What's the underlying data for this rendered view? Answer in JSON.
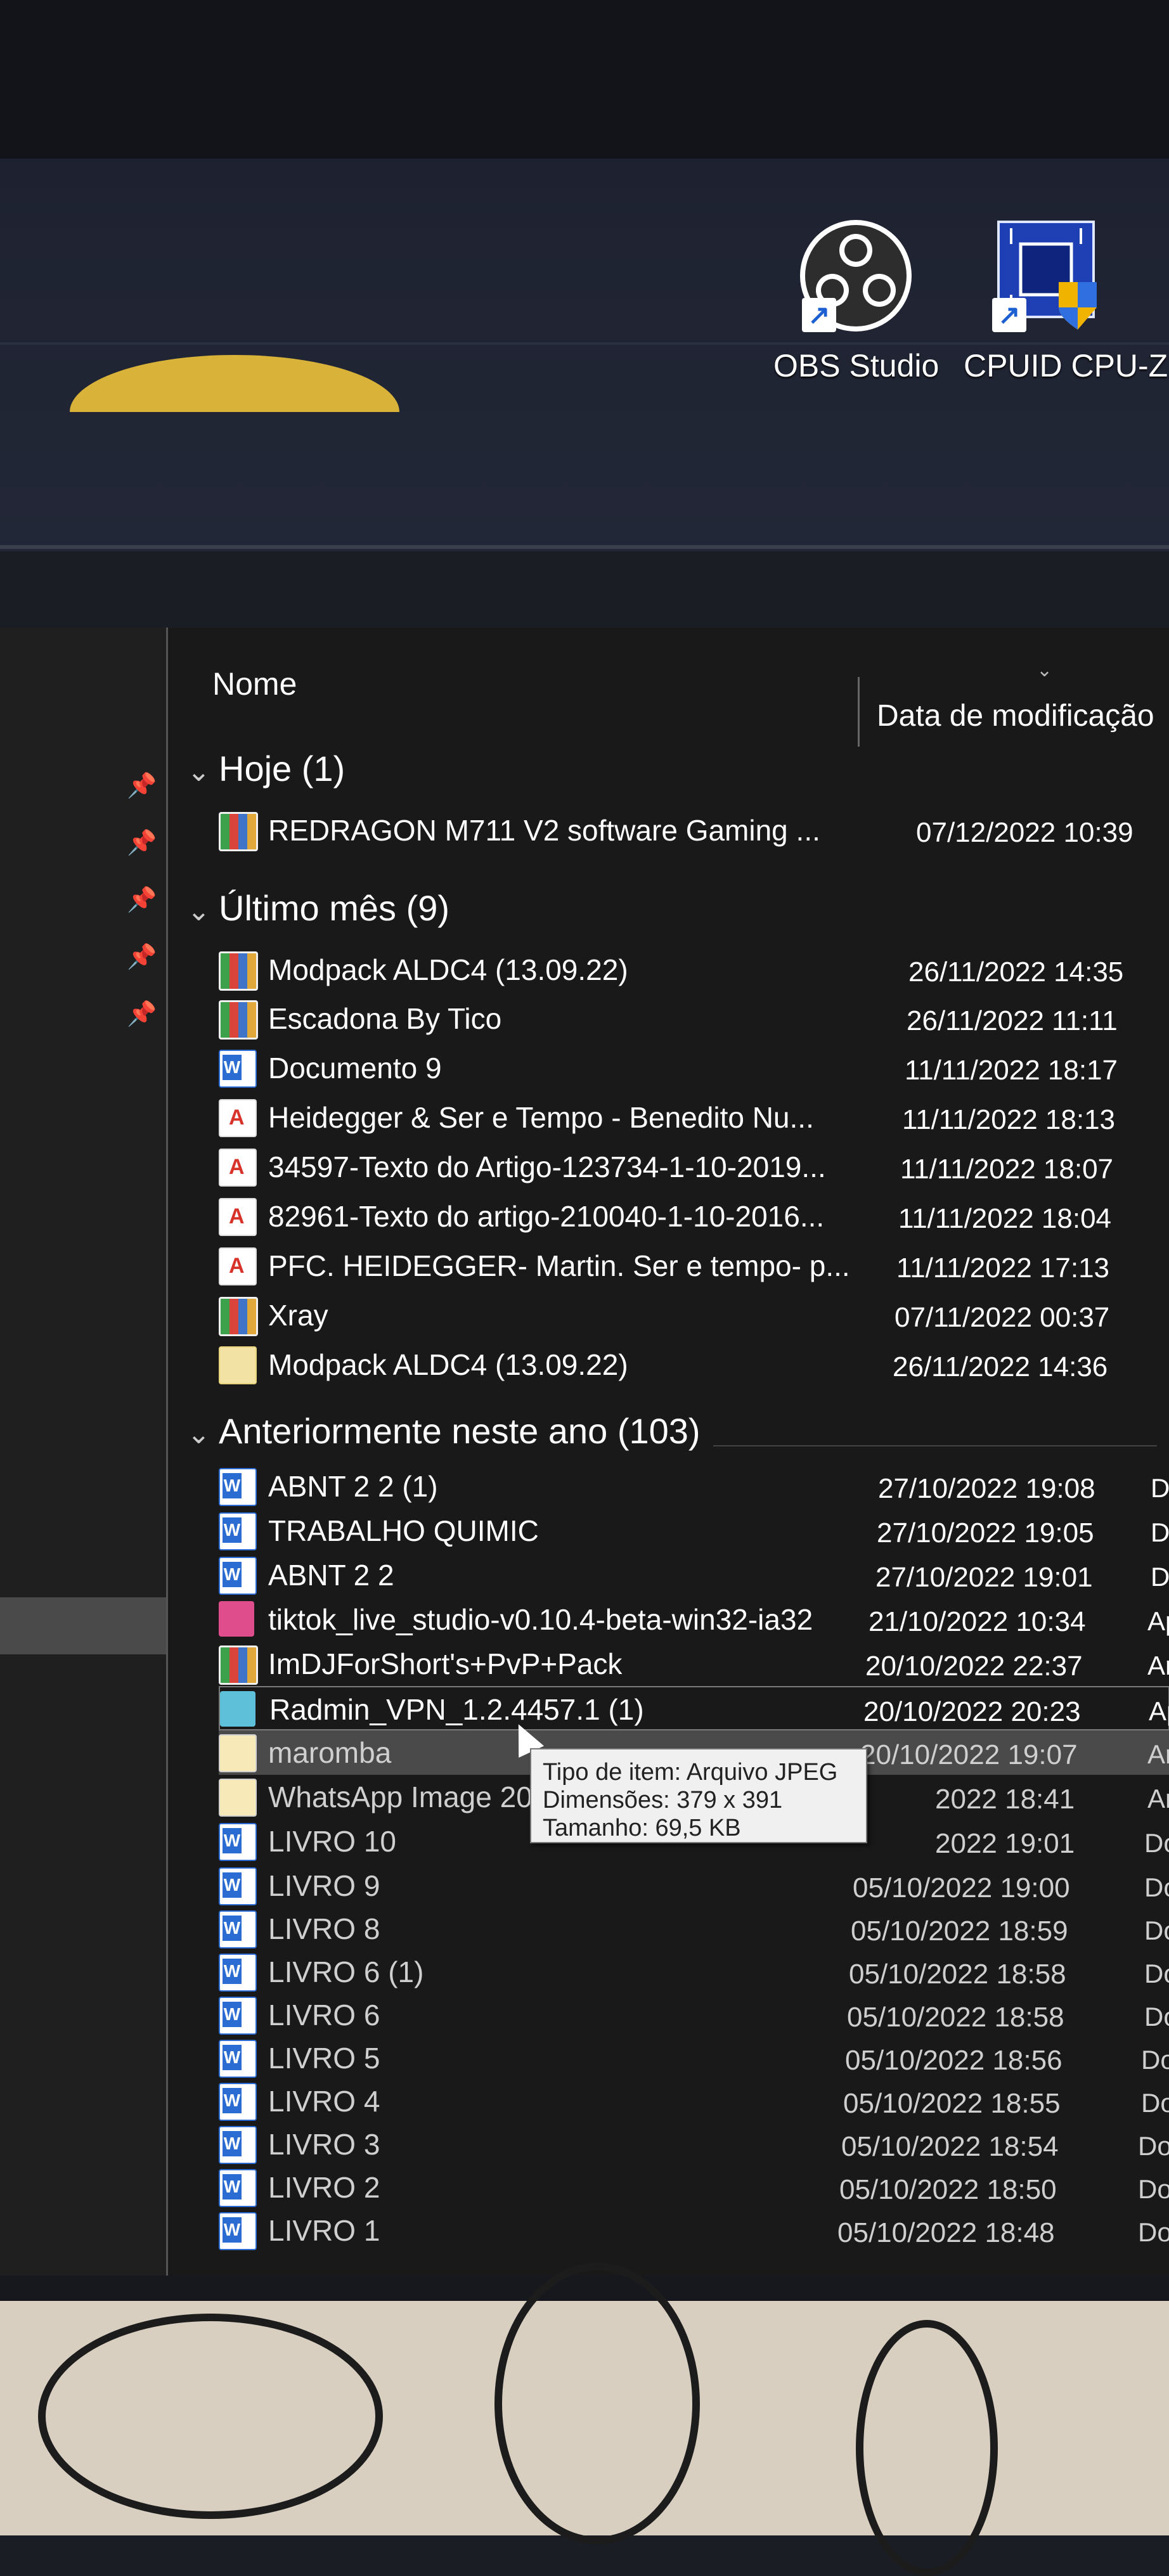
{
  "desktop": {
    "shortcuts": [
      {
        "label": "OBS Studio",
        "icon": "obs-icon"
      },
      {
        "label": "CPUID CPU-Z",
        "icon": "cpuz-icon"
      }
    ]
  },
  "explorer": {
    "columns": {
      "name": "Nome",
      "date": "Data de modificação"
    },
    "groups": [
      {
        "label": "Hoje (1)"
      },
      {
        "label": "Último mês (9)"
      },
      {
        "label": "Anteriormente neste ano (103)"
      }
    ],
    "today": [
      {
        "name": "REDRAGON  M711 V2  software Gaming ...",
        "date": "07/12/2022 10:39",
        "icon": "winrar-icon"
      }
    ],
    "last_month": [
      {
        "name": "Modpack ALDC4 (13.09.22)",
        "date": "26/11/2022 14:35",
        "icon": "winrar-icon"
      },
      {
        "name": "Escadona By Tico",
        "date": "26/11/2022 11:11",
        "icon": "winrar-icon"
      },
      {
        "name": "Documento 9",
        "date": "11/11/2022 18:17",
        "icon": "word-icon"
      },
      {
        "name": "Heidegger & Ser e Tempo - Benedito Nu...",
        "date": "11/11/2022 18:13",
        "icon": "pdf-icon"
      },
      {
        "name": "34597-Texto do Artigo-123734-1-10-2019...",
        "date": "11/11/2022 18:07",
        "icon": "pdf-icon"
      },
      {
        "name": "82961-Texto do artigo-210040-1-10-2016...",
        "date": "11/11/2022 18:04",
        "icon": "pdf-icon"
      },
      {
        "name": "PFC. HEIDEGGER- Martin. Ser e tempo- p...",
        "date": "11/11/2022 17:13",
        "icon": "pdf-icon"
      },
      {
        "name": "Xray",
        "date": "07/11/2022 00:37",
        "icon": "winrar-icon"
      },
      {
        "name": "Modpack ALDC4 (13.09.22)",
        "date": "26/11/2022 14:36",
        "icon": "folder-icon"
      }
    ],
    "earlier": [
      {
        "name": "ABNT 2 2 (1)",
        "date": "27/10/2022 19:08",
        "type": "D",
        "icon": "word-icon"
      },
      {
        "name": "TRABALHO QUIMIC",
        "date": "27/10/2022 19:05",
        "type": "D",
        "icon": "word-icon"
      },
      {
        "name": "ABNT 2 2",
        "date": "27/10/2022 19:01",
        "type": "D",
        "icon": "word-icon"
      },
      {
        "name": "tiktok_live_studio-v0.10.4-beta-win32-ia32",
        "date": "21/10/2022 10:34",
        "type": "Ap",
        "icon": "tiktok-icon"
      },
      {
        "name": "ImDJForShort's+PvP+Pack",
        "date": "20/10/2022 22:37",
        "type": "Ar",
        "icon": "winrar-icon"
      },
      {
        "name": "Radmin_VPN_1.2.4457.1 (1)",
        "date": "20/10/2022 20:23",
        "type": "Ap",
        "icon": "radmin-icon"
      },
      {
        "name": "maromba",
        "date": "20/10/2022 19:07",
        "type": "Arc",
        "icon": "image-icon"
      },
      {
        "name": "WhatsApp Image 2022",
        "date": "2022 18:41",
        "type": "Arq",
        "icon": "image-icon"
      },
      {
        "name": "LIVRO 10",
        "date": "2022 19:01",
        "type": "Doc",
        "icon": "word-icon"
      },
      {
        "name": "LIVRO 9",
        "date": "05/10/2022 19:00",
        "type": "Doc",
        "icon": "word-icon"
      },
      {
        "name": "LIVRO 8",
        "date": "05/10/2022 18:59",
        "type": "Docu",
        "icon": "word-icon"
      },
      {
        "name": "LIVRO 6 (1)",
        "date": "05/10/2022 18:58",
        "type": "Docu",
        "icon": "word-icon"
      },
      {
        "name": "LIVRO 6",
        "date": "05/10/2022 18:58",
        "type": "Docu",
        "icon": "word-icon"
      },
      {
        "name": "LIVRO 5",
        "date": "05/10/2022 18:56",
        "type": "Docu",
        "icon": "word-icon"
      },
      {
        "name": "LIVRO 4",
        "date": "05/10/2022 18:55",
        "type": "Docum",
        "icon": "word-icon"
      },
      {
        "name": "LIVRO 3",
        "date": "05/10/2022 18:54",
        "type": "Docum",
        "icon": "word-icon"
      },
      {
        "name": "LIVRO 2",
        "date": "05/10/2022 18:50",
        "type": "Docum",
        "icon": "word-icon"
      },
      {
        "name": "LIVRO 1",
        "date": "05/10/2022 18:48",
        "type": "Docum",
        "icon": "word-icon"
      }
    ],
    "tooltip": {
      "type_line": "Tipo de item: Arquivo JPEG",
      "dims_line": "Dimensões: 379 x 391",
      "size_line": "Tamanho: 69,5 KB"
    }
  }
}
